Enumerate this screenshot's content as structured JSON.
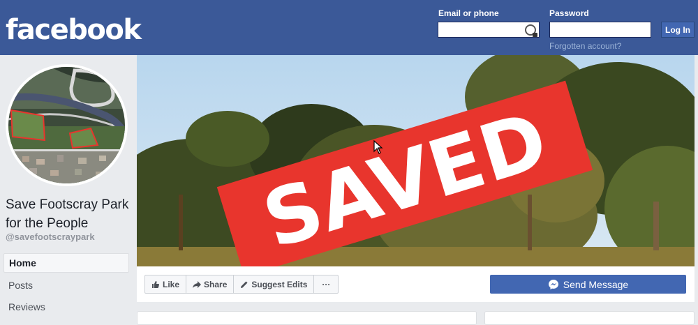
{
  "header": {
    "logo": "facebook",
    "email_label": "Email or phone",
    "password_label": "Password",
    "login_button": "Log In",
    "forgot_link": "Forgotten account?"
  },
  "icons": {
    "password_manager": "password-key-icon",
    "like": "thumbs-up-icon",
    "share": "share-arrow-icon",
    "suggest_edits": "pencil-icon",
    "more": "ellipsis-icon",
    "messenger": "messenger-icon"
  },
  "page": {
    "name": "Save Footscray Park for the People",
    "handle": "@savefootscraypark"
  },
  "nav": {
    "items": [
      {
        "label": "Home",
        "active": true
      },
      {
        "label": "Posts",
        "active": false
      },
      {
        "label": "Reviews",
        "active": false
      }
    ]
  },
  "cover": {
    "stamp_text": "SAVED",
    "stamp_color": "#e8352d"
  },
  "actions": {
    "like": "Like",
    "share": "Share",
    "suggest_edits": "Suggest Edits",
    "more": "···",
    "send_message": "Send Message"
  },
  "colors": {
    "brand": "#3b5998",
    "button": "#4267b2"
  }
}
